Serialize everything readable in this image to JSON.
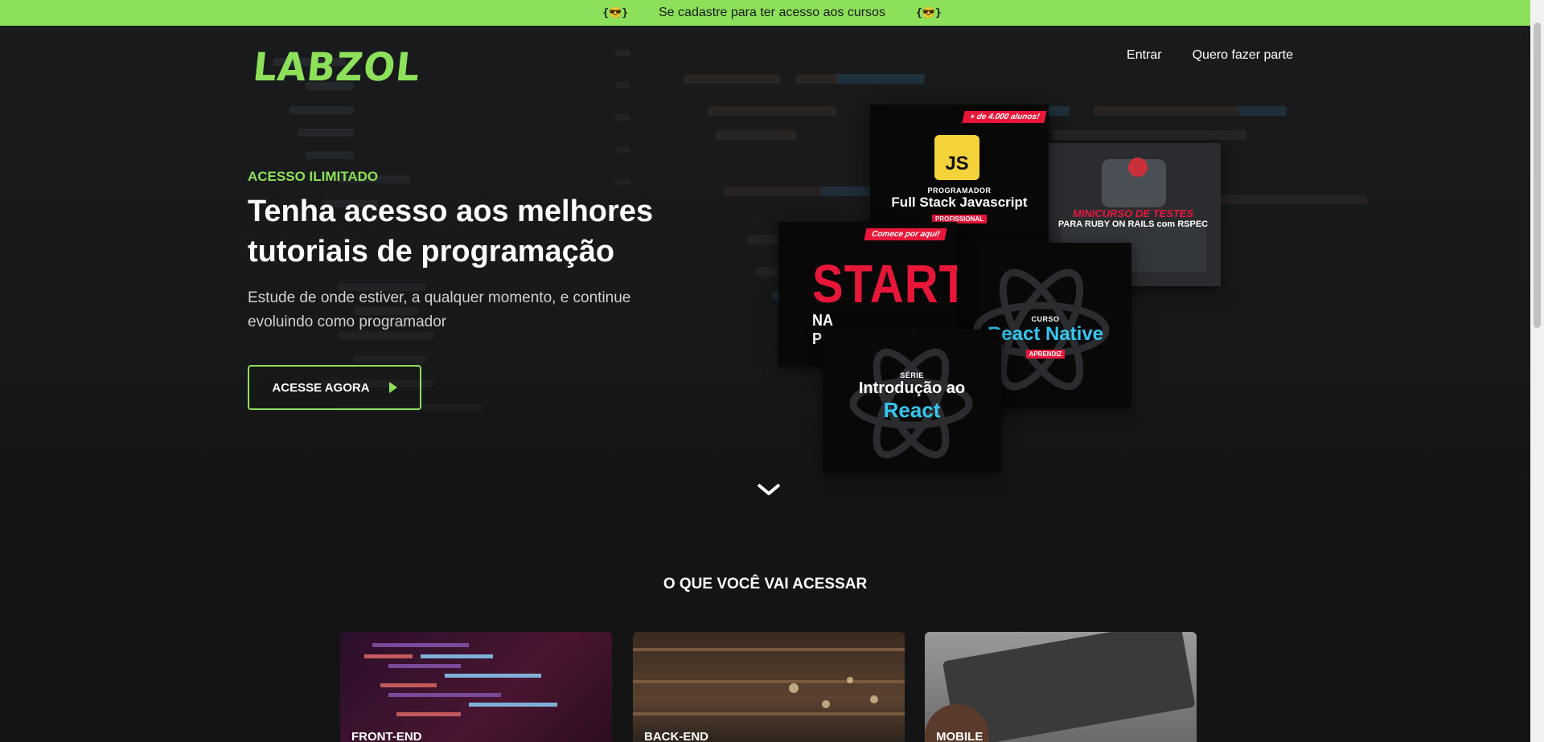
{
  "banner": {
    "text": "Se cadastre para ter acesso aos cursos",
    "emoji_left": "{😎}",
    "emoji_right": "{😎}"
  },
  "header": {
    "logo": "LABZOL",
    "nav": [
      {
        "label": "Entrar"
      },
      {
        "label": "Quero fazer parte"
      }
    ]
  },
  "hero": {
    "eyebrow": "ACESSO ILIMITADO",
    "headline": "Tenha acesso aos melhores tutoriais de programação",
    "subtext": "Estude de onde estiver, a qualquer momento, e continue evoluindo como programador",
    "cta_label": "ACESSE AGORA"
  },
  "covers": {
    "fullstack": {
      "ribbon": "+ de 4.000 alunos!",
      "badge": "JS",
      "kicker": "PROGRAMADOR",
      "title": "Full Stack Javascript",
      "tag": "PROFISSIONAL"
    },
    "rails": {
      "title": "MINICURSO DE TESTES",
      "subtitle": "PARA RUBY ON RAILS com RSPEC"
    },
    "start": {
      "ribbon": "Comece por aqui!",
      "title": "START",
      "subtitle": "NA PROGRAMAÇÃO"
    },
    "react_native": {
      "kicker": "CURSO",
      "title": "React Native",
      "tag": "APRENDIZ"
    },
    "react_intro": {
      "kicker": "SÉRIE",
      "title": "Introdução ao",
      "highlight": "React"
    }
  },
  "section": {
    "title": "O QUE VOCÊ VAI ACESSAR",
    "cards": [
      {
        "label": "FRONT-END"
      },
      {
        "label": "BACK-END"
      },
      {
        "label": "MOBILE"
      }
    ]
  },
  "colors": {
    "accent": "#8ce05a",
    "background": "#141414",
    "brand_red": "#e8173a",
    "react_cyan": "#36c7f0",
    "js_yellow": "#f4d33a"
  },
  "icons": {
    "cta": "play-icon",
    "scroll": "chevron-down-icon",
    "banner": "sunglasses-emoji-icon"
  }
}
